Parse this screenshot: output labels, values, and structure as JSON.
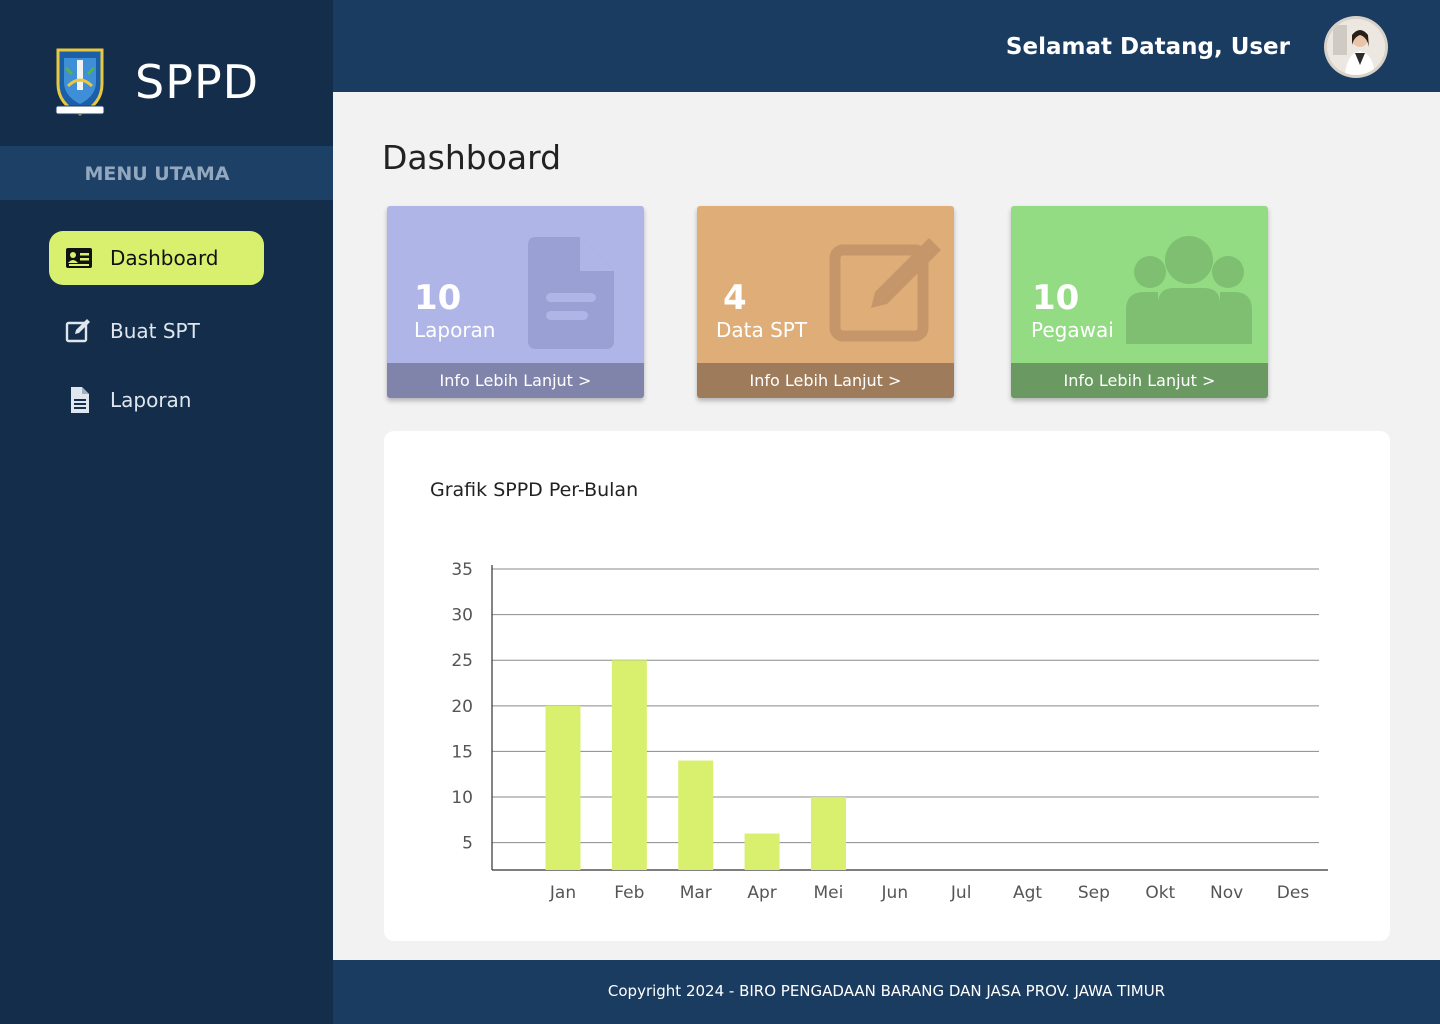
{
  "app": {
    "title": "SPPD"
  },
  "sidebar": {
    "menu_heading": "MENU UTAMA",
    "items": [
      {
        "label": "Dashboard",
        "icon": "id-card-icon",
        "active": true
      },
      {
        "label": "Buat SPT",
        "icon": "edit-icon",
        "active": false
      },
      {
        "label": "Laporan",
        "icon": "document-icon",
        "active": false
      }
    ]
  },
  "header": {
    "welcome": "Selamat Datang, User",
    "avatar": "user-avatar"
  },
  "main": {
    "title": "Dashboard",
    "cards": [
      {
        "value": "10",
        "label": "Laporan",
        "link": "Info Lebih Lanjut >",
        "icon": "document-icon",
        "color": "#b0b5e8",
        "footer_color": "#8084aa"
      },
      {
        "value": "4",
        "label": "Data SPT",
        "link": "Info Lebih Lanjut >",
        "icon": "edit-icon",
        "color": "#dfae78",
        "footer_color": "#9e7c5b"
      },
      {
        "value": "10",
        "label": "Pegawai",
        "link": "Info Lebih Lanjut >",
        "icon": "users-icon",
        "color": "#93dc84",
        "footer_color": "#6a9a62"
      }
    ]
  },
  "chart_data": {
    "type": "bar",
    "title": "Grafik SPPD Per-Bulan",
    "categories": [
      "Jan",
      "Feb",
      "Mar",
      "Apr",
      "Mei",
      "Jun",
      "Jul",
      "Agt",
      "Sep",
      "Okt",
      "Nov",
      "Des"
    ],
    "values": [
      20,
      25,
      14,
      6,
      10,
      0,
      0,
      0,
      0,
      0,
      0,
      0
    ],
    "yticks": [
      5,
      10,
      15,
      20,
      25,
      30,
      35
    ],
    "ylim": [
      2,
      35
    ],
    "grid": true,
    "bar_color": "#d8f06d"
  },
  "footer": {
    "text": "Copyright 2024 - BIRO PENGADAAN BARANG DAN JASA PROV. JAWA TIMUR"
  }
}
